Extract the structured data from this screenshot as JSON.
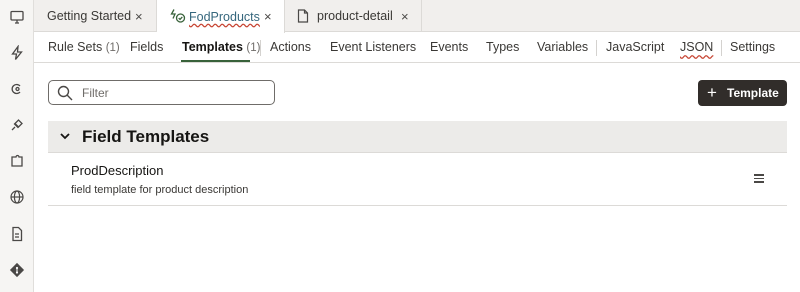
{
  "doc_tabs": [
    {
      "label": "Getting Started",
      "close": "×"
    },
    {
      "label": "FodProducts",
      "close": "×"
    },
    {
      "label": "product-detail",
      "close": "×"
    }
  ],
  "sub_tabs": [
    {
      "label": "Rule Sets",
      "count": "(1)"
    },
    {
      "label": "Fields",
      "count": ""
    },
    {
      "label": "Templates",
      "count": "(1)"
    },
    {
      "label": "Actions",
      "count": ""
    },
    {
      "label": "Event Listeners",
      "count": ""
    },
    {
      "label": "Events",
      "count": ""
    },
    {
      "label": "Types",
      "count": ""
    },
    {
      "label": "Variables",
      "count": ""
    },
    {
      "label": "JavaScript",
      "count": ""
    },
    {
      "label": "JSON",
      "count": ""
    },
    {
      "label": "Settings",
      "count": ""
    }
  ],
  "active_sub_tab": "Templates",
  "toolbar": {
    "filter_placeholder": "Filter",
    "add_button_label": "Template",
    "add_button_icon": "plus-icon"
  },
  "section": {
    "title": "Field Templates",
    "items": [
      {
        "name": "ProdDescription",
        "description": "field template for product description"
      }
    ]
  },
  "rail_icons": [
    "monitor-icon",
    "bolt-icon",
    "copyright-icon",
    "plug-icon",
    "puzzle-icon",
    "globe-icon",
    "document-icon",
    "git-icon"
  ],
  "colors": {
    "active_tab_underline": "#38623a",
    "primary_button": "#312d2a",
    "section_header_bg": "#ecebe9",
    "link_text": "#36677d"
  }
}
